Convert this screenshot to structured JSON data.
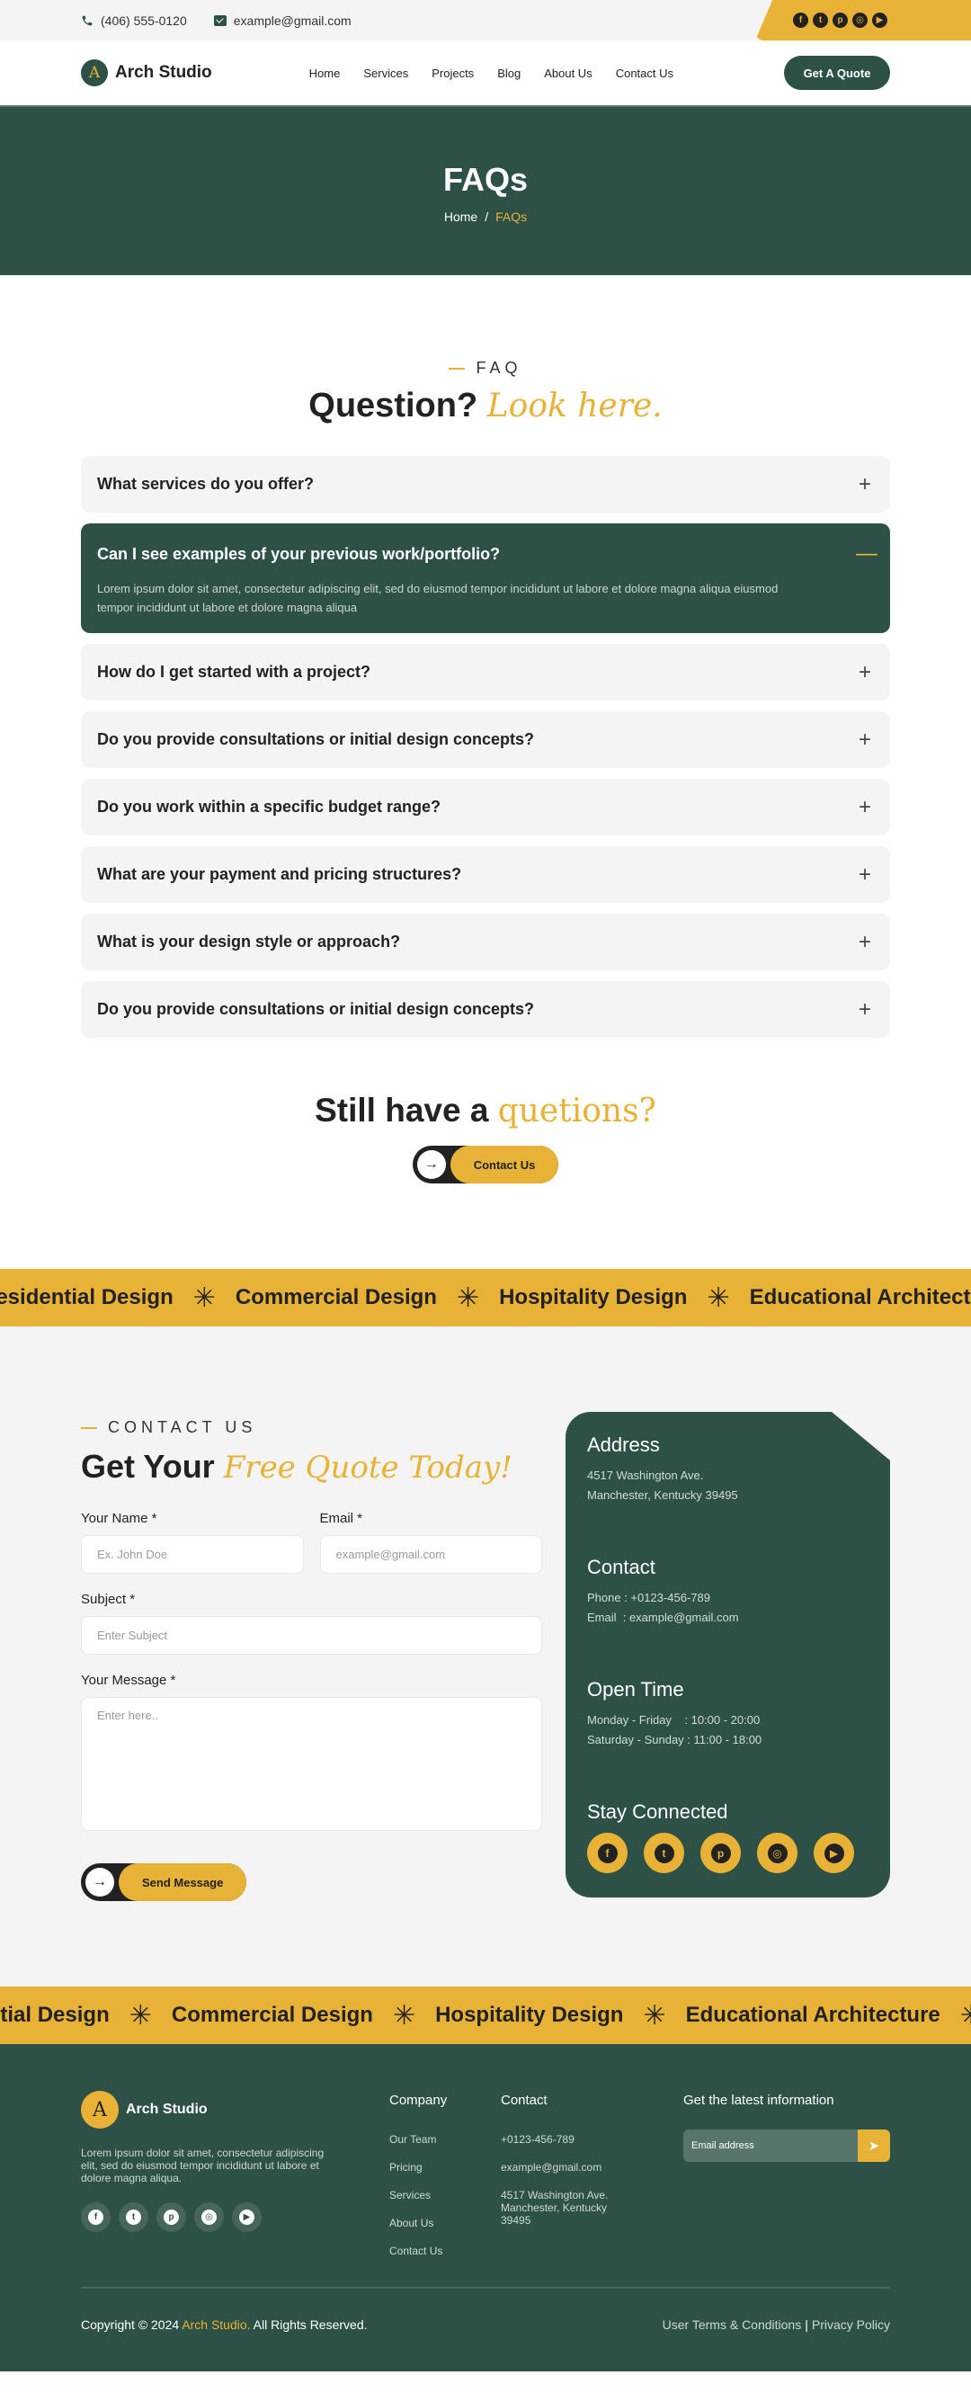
{
  "topbar": {
    "phone": "(406) 555-0120",
    "email": "example@gmail.com",
    "socials": [
      {
        "name": "facebook",
        "glyph": "f"
      },
      {
        "name": "twitter",
        "glyph": "t"
      },
      {
        "name": "pinterest",
        "glyph": "p"
      },
      {
        "name": "instagram",
        "glyph": "◎"
      },
      {
        "name": "youtube",
        "glyph": "▶"
      }
    ]
  },
  "nav": {
    "logo_letter": "A",
    "brand": "Arch Studio",
    "items": [
      "Home",
      "Services",
      "Projects",
      "Blog",
      "About Us",
      "Contact Us"
    ],
    "cta": "Get A Quote"
  },
  "hero": {
    "title": "FAQs",
    "breadcrumb": {
      "home": "Home",
      "sep": "/",
      "current": "FAQs"
    }
  },
  "faq": {
    "eyebrow": "FAQ",
    "title_main": "Question?",
    "title_accent": "Look here.",
    "items": [
      {
        "q": "What services do you offer?",
        "open": false,
        "toggle": "+"
      },
      {
        "q": "Can I see examples of your previous work/portfolio?",
        "open": true,
        "toggle": "—",
        "a": "Lorem ipsum dolor sit amet, consectetur adipiscing elit, sed do eiusmod tempor incididunt ut labore et dolore magna aliqua eiusmod tempor incididunt ut labore et dolore magna aliqua"
      },
      {
        "q": "How do I get started with a project?",
        "open": false,
        "toggle": "+"
      },
      {
        "q": "Do you provide consultations or initial design concepts?",
        "open": false,
        "toggle": "+"
      },
      {
        "q": "Do you work within a specific budget range?",
        "open": false,
        "toggle": "+"
      },
      {
        "q": "What are your payment and pricing structures?",
        "open": false,
        "toggle": "+"
      },
      {
        "q": "What is your design style or approach?",
        "open": false,
        "toggle": "+"
      },
      {
        "q": "Do you provide consultations or initial design concepts?",
        "open": false,
        "toggle": "+"
      }
    ],
    "still_main": "Still have a",
    "still_accent": "quetions?",
    "contact_button": "Contact Us",
    "arrow_glyph": "→"
  },
  "marquee_top": [
    "Residential Design",
    "Commercial Design",
    "Hospitality Design",
    "Educational Architecture"
  ],
  "marquee_bottom": [
    "Residential Design",
    "Commercial Design",
    "Hospitality Design",
    "Educational Architecture"
  ],
  "marquee_star": "✳",
  "contact": {
    "eyebrow": "CONTACT US",
    "title_main": "Get Your",
    "title_accent": "Free Quote Today!",
    "fields": {
      "name": {
        "label": "Your Name *",
        "placeholder": "Ex. John Doe",
        "value": ""
      },
      "email": {
        "label": "Email *",
        "placeholder": "example@gmail.com",
        "value": ""
      },
      "subject": {
        "label": "Subject *",
        "placeholder": "Enter Subject",
        "value": ""
      },
      "message": {
        "label": "Your Message *",
        "placeholder": "Enter here..",
        "value": ""
      }
    },
    "send_button": "Send Message"
  },
  "info": {
    "address_title": "Address",
    "address_lines": [
      "4517 Washington Ave.",
      "Manchester, Kentucky 39495"
    ],
    "contact_title": "Contact",
    "contact_lines": [
      "Phone : +0123-456-789",
      "Email  : example@gmail.com"
    ],
    "open_title": "Open Time",
    "open_lines": [
      "Monday - Friday    : 10:00 - 20:00",
      "Saturday - Sunday : 11:00 - 18:00"
    ],
    "social_title": "Stay Connected"
  },
  "footer": {
    "brand": "Arch Studio",
    "about": "Lorem ipsum dolor sit amet, consectetur adipiscing elit, sed do eiusmod tempor incididunt ut labore et dolore magna aliqua.",
    "company_title": "Company",
    "company_links": [
      "Our Team",
      "Pricing",
      "Services",
      "About Us",
      "Contact Us"
    ],
    "contact_title": "Contact",
    "contact_lines": [
      "+0123-456-789",
      "example@gmail.com",
      "4517 Washington Ave. Manchester, Kentucky 39495"
    ],
    "news_title": "Get the latest information",
    "news_placeholder": "Email address",
    "copyright_pre": "Copyright © 2024",
    "copyright_brand": "Arch Studio.",
    "copyright_post": "All Rights Reserved.",
    "terms": "User Terms & Conditions",
    "privacy": "Privacy Policy"
  }
}
